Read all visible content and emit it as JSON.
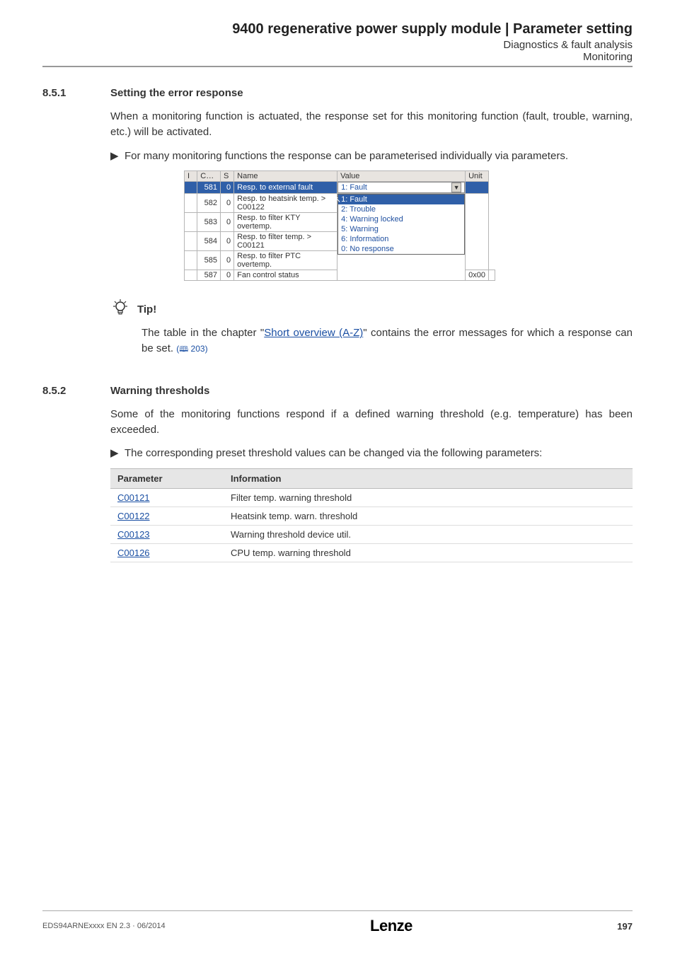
{
  "header": {
    "title": "9400 regenerative power supply module | Parameter setting",
    "sub1": "Diagnostics & fault analysis",
    "sub2": "Monitoring"
  },
  "sec851": {
    "num": "8.5.1",
    "title": "Setting the error response",
    "para": "When a monitoring function is actuated, the response set for this monitoring function (fault, trouble, warning, etc.) will be activated.",
    "bullet": "For many monitoring functions the response can be parameterised individually via parameters."
  },
  "gui": {
    "hdr": {
      "i": "I",
      "c": "C…",
      "s": "S",
      "name": "Name",
      "value": "Value",
      "unit": "Unit"
    },
    "selected_value": "1:  Fault",
    "rows": [
      {
        "c": "581",
        "s": "0",
        "name": "Resp. to external fault"
      },
      {
        "c": "582",
        "s": "0",
        "name": "Resp. to heatsink temp. > C00122"
      },
      {
        "c": "583",
        "s": "0",
        "name": "Resp. to filter KTY overtemp."
      },
      {
        "c": "584",
        "s": "0",
        "name": "Resp. to filter temp. > C00121"
      },
      {
        "c": "585",
        "s": "0",
        "name": "Resp. to filter PTC overtemp."
      },
      {
        "c": "587",
        "s": "0",
        "name": "Fan control status"
      }
    ],
    "dropdown": [
      "1:    Fault",
      "2:    Trouble",
      "4:    Warning locked",
      "5:    Warning",
      "6:    Information",
      "0:    No response"
    ],
    "lastval": "0x00"
  },
  "tip": {
    "label": "Tip!",
    "body_pre": "The table in the chapter \"",
    "body_link": "Short overview (A-Z)",
    "body_post": "\" contains the error messages for which a response can be set.  ",
    "pageref": "203"
  },
  "sec852": {
    "num": "8.5.2",
    "title": "Warning thresholds",
    "para": "Some of the monitoring functions respond if a defined warning threshold (e.g. temperature) has been exceeded.",
    "bullet": "The corresponding preset threshold values can be changed via the following parameters:",
    "table": {
      "h1": "Parameter",
      "h2": "Information",
      "rows": [
        {
          "code": "C00121",
          "info": "Filter temp. warning threshold"
        },
        {
          "code": "C00122",
          "info": "Heatsink temp. warn. threshold"
        },
        {
          "code": "C00123",
          "info": "Warning threshold device util."
        },
        {
          "code": "C00126",
          "info": "CPU temp. warning threshold"
        }
      ]
    }
  },
  "footer": {
    "docid": "EDS94ARNExxxx EN 2.3 · 06/2014",
    "logo": "Lenze",
    "page": "197"
  }
}
